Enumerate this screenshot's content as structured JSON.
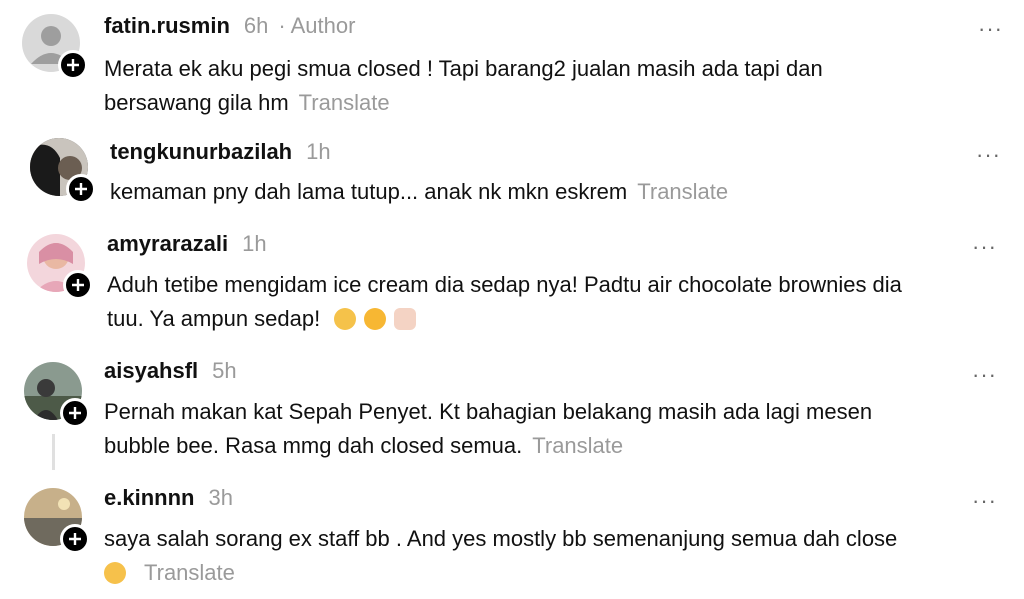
{
  "comments": [
    {
      "username": "fatin.rusmin",
      "time": "6h",
      "author_label": "· Author",
      "text_line1": "Merata ek aku pegi smua closed ! Tapi barang2 jualan masih ada tapi dan",
      "text_line2": "bersawang gila hm",
      "translate": "Translate",
      "more": "···"
    },
    {
      "username": "tengkunurbazilah",
      "time": "1h",
      "text_line1": "kemaman pny dah lama tutup... anak nk mkn eskrem",
      "translate": "Translate",
      "more": "···"
    },
    {
      "username": "amyrarazali",
      "time": "1h",
      "text_line1": "Aduh tetibe mengidam ice cream dia sedap nya! Padtu air chocolate brownies dia",
      "text_line2": "tuu. Ya ampun sedap!",
      "emojis": [
        "crying-face-emoji",
        "pleading-face-emoji",
        "fist-emoji"
      ],
      "more": "···"
    },
    {
      "username": "aisyahsfl",
      "time": "5h",
      "text_line1": "Pernah makan kat Sepah Penyet. Kt bahagian belakang masih ada lagi mesen",
      "text_line2": "bubble bee. Rasa mmg dah closed semua.",
      "translate": "Translate",
      "more": "···"
    },
    {
      "username": "e.kinnnn",
      "time": "3h",
      "text_line1": "saya salah sorang ex staff bb . And yes mostly bb semenanjung semua dah close",
      "emojis": [
        "smiling-face-emoji"
      ],
      "translate": "Translate",
      "more": "···"
    }
  ],
  "colors": {
    "text": "#111111",
    "muted": "#9a9a9a",
    "badge": "#000000"
  }
}
